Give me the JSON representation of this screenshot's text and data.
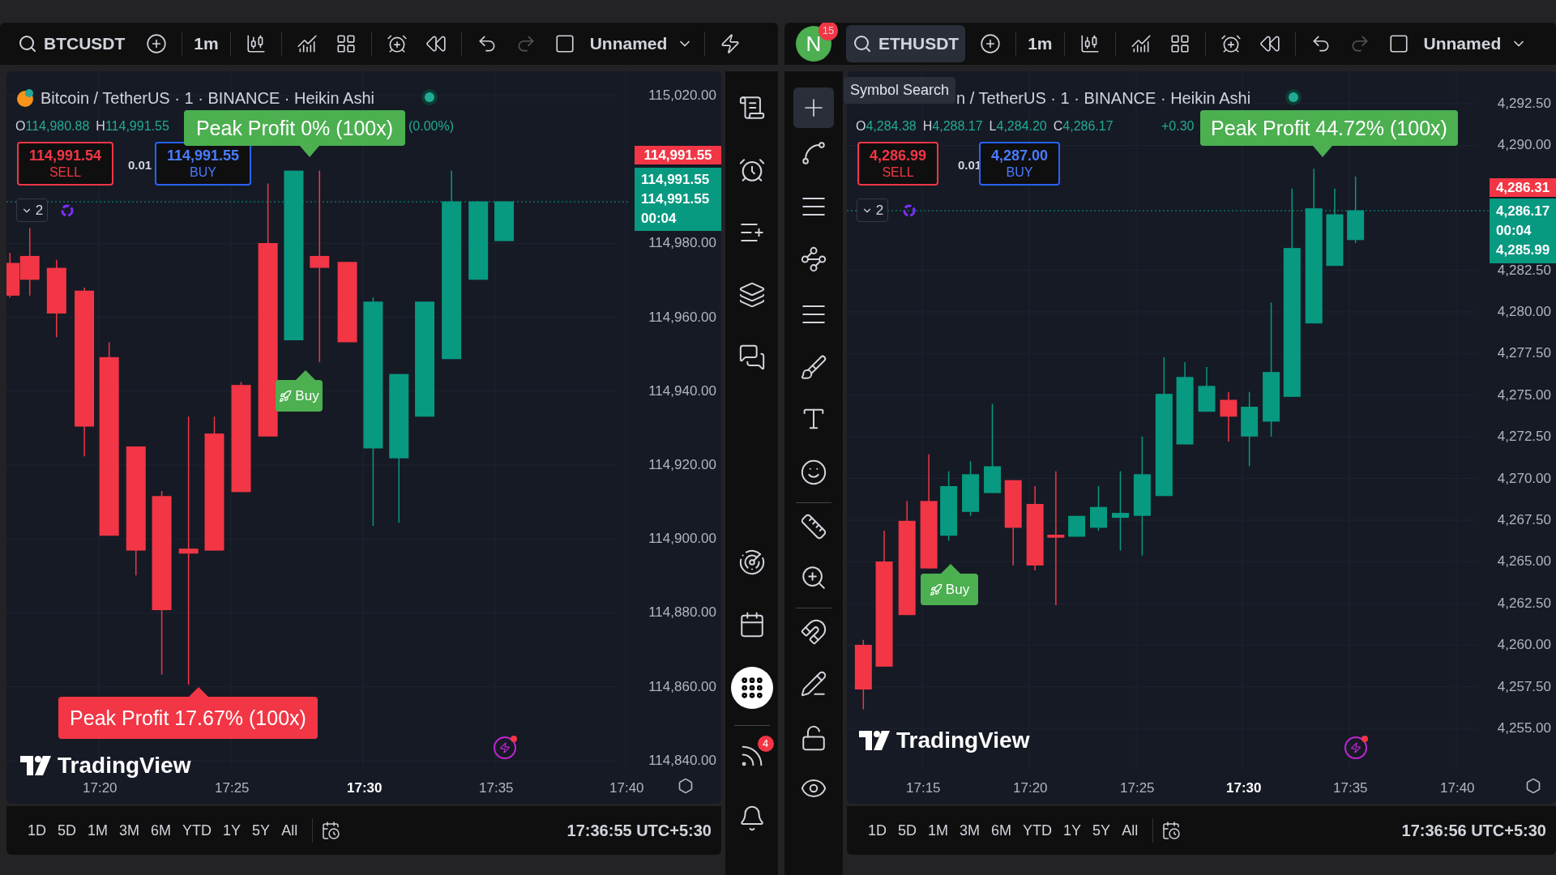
{
  "charts": [
    {
      "toolbar": {
        "symbol": "BTCUSDT",
        "symbol_selected": false,
        "interval": "1m",
        "layout_name": "Unnamed"
      },
      "title": "Bitcoin / TetherUS · 1 · BINANCE · Heikin Ashi",
      "ohlc": [
        {
          "label": "O",
          "value": "114,980.88"
        },
        {
          "label": "H",
          "value": "114,991.55"
        }
      ],
      "change": "(0.00%)",
      "sell": {
        "price": "114,991.54",
        "label": "SELL"
      },
      "spread": "0.01",
      "buy": {
        "price": "114,991.55",
        "label": "BUY"
      },
      "indicator_count": "2",
      "price_axis": [
        "115,020.00",
        "114,980.00",
        "114,960.00",
        "114,940.00",
        "114,920.00",
        "114,900.00",
        "114,880.00",
        "114,860.00",
        "114,840.00"
      ],
      "bid_tag": "114,991.55",
      "last_tag": [
        "114,991.55",
        "114,991.55",
        "00:04"
      ],
      "signals": [
        {
          "kind": "peak",
          "text": "Peak Profit 0% (100x)",
          "color": "#4caf50"
        },
        {
          "kind": "buy",
          "text": "Buy",
          "color": "#4caf50"
        },
        {
          "kind": "peak",
          "text": "Peak Profit 17.67% (100x)",
          "color": "#f23645"
        }
      ],
      "watermark": "TradingView",
      "time_axis": [
        {
          "label": "17:20",
          "major": false
        },
        {
          "label": "17:25",
          "major": false
        },
        {
          "label": "17:30",
          "major": true
        },
        {
          "label": "17:35",
          "major": false
        },
        {
          "label": "17:40",
          "major": false
        }
      ],
      "ranges": [
        "1D",
        "5D",
        "1M",
        "3M",
        "6M",
        "YTD",
        "1Y",
        "5Y",
        "All"
      ],
      "clock": "17:36:55 UTC+5:30"
    },
    {
      "toolbar": {
        "avatar": "N",
        "avatar_badge": "15",
        "symbol": "ETHUSDT",
        "symbol_selected": true,
        "interval": "1m",
        "layout_name": "Unnamed"
      },
      "tooltip": "Symbol Search",
      "title": "n / TetherUS · 1 · BINANCE · Heikin Ashi",
      "ohlc": [
        {
          "label": "O",
          "value": "4,284.38"
        },
        {
          "label": "H",
          "value": "4,288.17"
        },
        {
          "label": "L",
          "value": "4,284.20"
        },
        {
          "label": "C",
          "value": "4,286.17"
        }
      ],
      "change": "+0.30",
      "sell": {
        "price": "4,286.99",
        "label": "SELL"
      },
      "spread": "0.01",
      "buy": {
        "price": "4,287.00",
        "label": "BUY"
      },
      "indicator_count": "2",
      "price_axis": [
        "4,292.50",
        "4,290.00",
        "4,282.50",
        "4,280.00",
        "4,277.50",
        "4,275.00",
        "4,272.50",
        "4,270.00",
        "4,267.50",
        "4,265.00",
        "4,262.50",
        "4,260.00",
        "4,257.50",
        "4,255.00"
      ],
      "bid_tag": "4,286.31",
      "last_tag": [
        "4,286.17",
        "00:04",
        "4,285.99"
      ],
      "signals": [
        {
          "kind": "peak",
          "text": "Peak Profit 44.72% (100x)",
          "color": "#4caf50"
        },
        {
          "kind": "buy",
          "text": "Buy",
          "color": "#4caf50"
        }
      ],
      "watermark": "TradingView",
      "time_axis": [
        {
          "label": "17:15",
          "major": false
        },
        {
          "label": "17:20",
          "major": false
        },
        {
          "label": "17:25",
          "major": false
        },
        {
          "label": "17:30",
          "major": true
        },
        {
          "label": "17:35",
          "major": false
        },
        {
          "label": "17:40",
          "major": false
        }
      ],
      "ranges": [
        "1D",
        "5D",
        "1M",
        "3M",
        "6M",
        "YTD",
        "1Y",
        "5Y",
        "All"
      ],
      "clock": "17:36:56 UTC+5:30"
    }
  ],
  "widget_bar": {
    "feed_badge": "4"
  }
}
